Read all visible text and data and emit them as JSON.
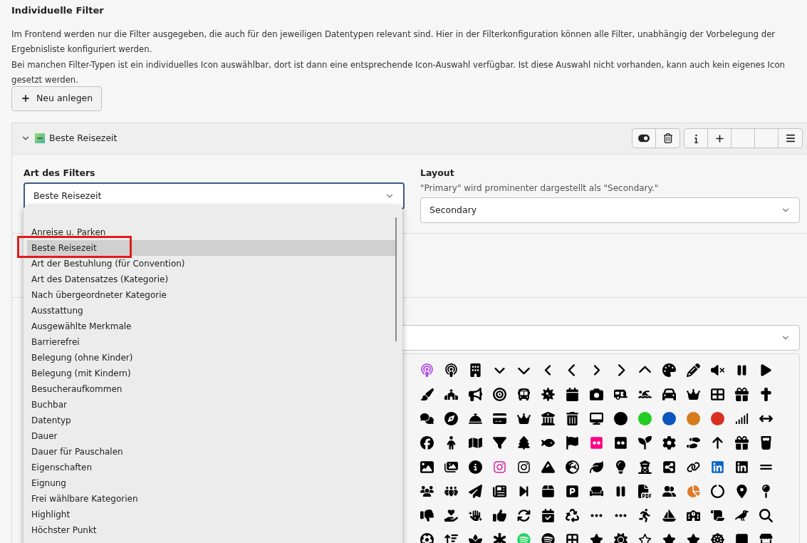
{
  "section_title": "Individuelle Filter",
  "description": [
    "Im Frontend werden nur die Filter ausgegeben, die auch für den jeweiligen Datentypen relevant sind. Hier in der Filterkonfiguration können alle Filter, unabhängig der Vorbelegung der Ergebnisliste konfiguriert werden.",
    "Bei manchen Filter-Typen ist ein individuelles Icon auswählbar, dort ist dann eine entsprechende Icon-Auswahl verfügbar. Ist diese Auswahl nicht vorhanden, kann auch kein eigenes Icon gesetzt werden."
  ],
  "new_button": {
    "label": "Neu anlegen"
  },
  "filter_panel": {
    "title": "Beste Reisezeit",
    "expanded": true,
    "filter_type": {
      "label": "Art des Filters",
      "value": "Beste Reisezeit",
      "options": [
        {
          "label": "Anreise u. Parken",
          "selected": false
        },
        {
          "label": "Beste Reisezeit",
          "selected": true
        },
        {
          "label": "Art der Bestuhlung (für Convention)",
          "selected": false
        },
        {
          "label": "Art des Datensatzes (Kategorie)",
          "selected": false
        },
        {
          "label": "Nach übergeordneter Kategorie",
          "selected": false
        },
        {
          "label": "Ausstattung",
          "selected": false
        },
        {
          "label": "Ausgewählte Merkmale",
          "selected": false
        },
        {
          "label": "Barrierefrei",
          "selected": false
        },
        {
          "label": "Belegung (ohne Kinder)",
          "selected": false
        },
        {
          "label": "Belegung (mit Kindern)",
          "selected": false
        },
        {
          "label": "Besucheraufkommen",
          "selected": false
        },
        {
          "label": "Buchbar",
          "selected": false
        },
        {
          "label": "Datentyp",
          "selected": false
        },
        {
          "label": "Dauer",
          "selected": false
        },
        {
          "label": "Dauer für Pauschalen",
          "selected": false
        },
        {
          "label": "Eigenschaften",
          "selected": false
        },
        {
          "label": "Eignung",
          "selected": false
        },
        {
          "label": "Frei wählbare Kategorien",
          "selected": false
        },
        {
          "label": "Highlight",
          "selected": false
        },
        {
          "label": "Höchster Punkt",
          "selected": false
        }
      ]
    },
    "layout": {
      "label": "Layout",
      "hint": "\"Primary\" wird prominenter dargestellt als \"Secondary.\"",
      "value": "Secondary"
    }
  }
}
